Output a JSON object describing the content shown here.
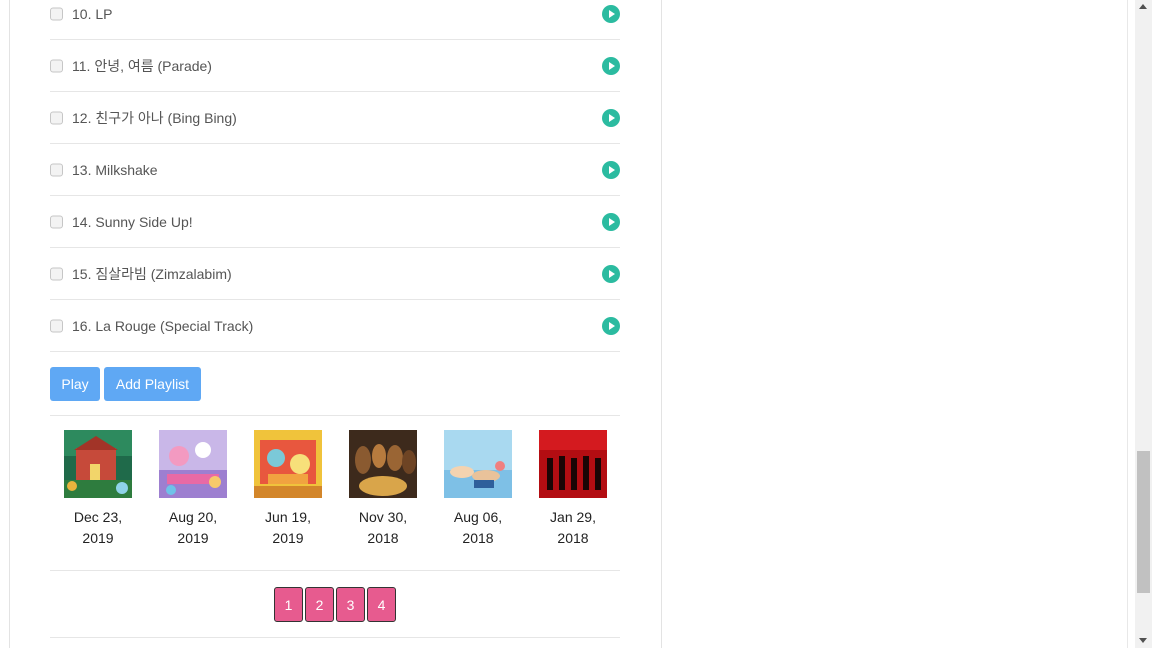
{
  "tracks": [
    {
      "label": "10. LP"
    },
    {
      "label": "11. 안녕, 여름 (Parade)"
    },
    {
      "label": "12. 친구가 아나 (Bing Bing)"
    },
    {
      "label": "13. Milkshake"
    },
    {
      "label": "14. Sunny Side Up!"
    },
    {
      "label": "15. 짐살라빔 (Zimzalabim)"
    },
    {
      "label": "16. La Rouge (Special Track)"
    }
  ],
  "actions": {
    "play_label": "Play",
    "add_playlist_label": "Add Playlist"
  },
  "albums": [
    {
      "date_line1": "Dec 23,",
      "date_line2": "2019"
    },
    {
      "date_line1": "Aug 20,",
      "date_line2": "2019"
    },
    {
      "date_line1": "Jun 19,",
      "date_line2": "2019"
    },
    {
      "date_line1": "Nov 30,",
      "date_line2": "2018"
    },
    {
      "date_line1": "Aug 06,",
      "date_line2": "2018"
    },
    {
      "date_line1": "Jan 29,",
      "date_line2": "2018"
    }
  ],
  "pagination": [
    "1",
    "2",
    "3",
    "4"
  ],
  "colors": {
    "play_icon": "#2bbba0",
    "button": "#5fa8f4",
    "page_button": "#e75b8f"
  }
}
